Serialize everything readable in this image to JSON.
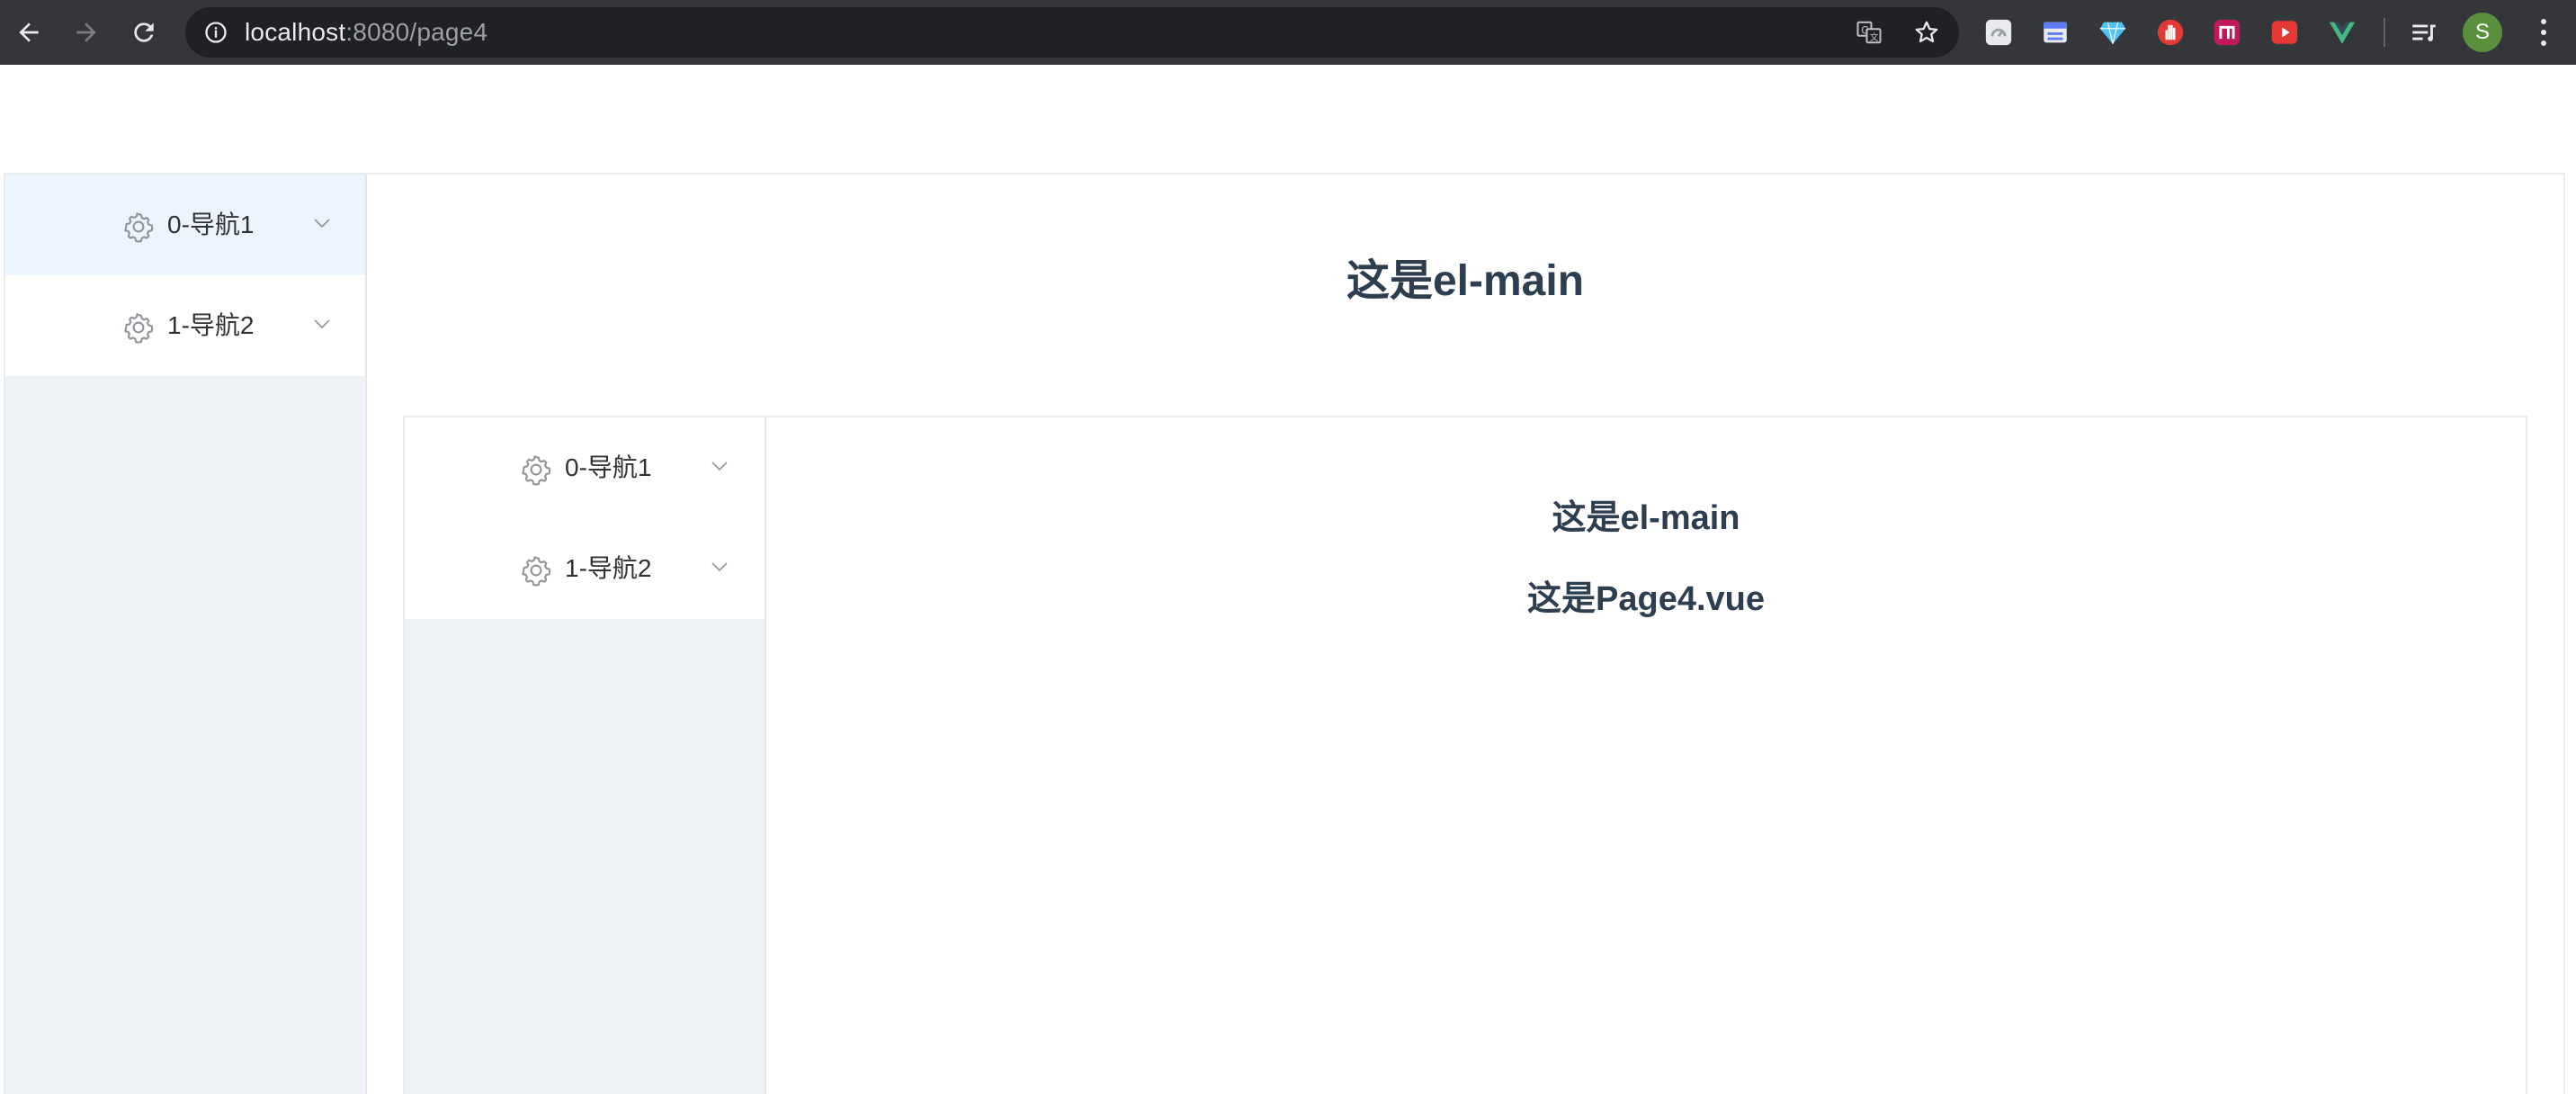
{
  "browser": {
    "url_host": "localhost",
    "url_rest": ":8080/page4",
    "profile_initial": "S",
    "icons": {
      "back": "arrow-left-icon",
      "forward": "arrow-right-icon",
      "reload": "reload-icon",
      "info": "info-icon",
      "translate": "translate-icon",
      "bookmark": "star-icon",
      "media": "media-queue-icon",
      "menu": "vertical-dots-icon"
    },
    "extensions": [
      {
        "name": "speedometer-extension-icon",
        "color": "#e8eaed"
      },
      {
        "name": "window-extension-icon",
        "color": "#8ab4f8"
      },
      {
        "name": "diamond-extension-icon",
        "color": "#4fc3f7"
      },
      {
        "name": "hand-stop-extension-icon",
        "color": "#e53935"
      },
      {
        "name": "n-badge-extension-icon",
        "color": "#c2185b"
      },
      {
        "name": "play-extension-icon",
        "color": "#e53935"
      },
      {
        "name": "vue-extension-icon",
        "color": "#42b883"
      }
    ]
  },
  "outer": {
    "menu": [
      {
        "label": "0-导航1",
        "icon": "gear-icon",
        "active": true
      },
      {
        "label": "1-导航2",
        "icon": "gear-icon",
        "active": false
      }
    ],
    "main_title": "这是el-main"
  },
  "inner": {
    "menu": [
      {
        "label": "0-导航1",
        "icon": "gear-icon"
      },
      {
        "label": "1-导航2",
        "icon": "gear-icon"
      }
    ],
    "main_title": "这是el-main",
    "page_text": "这是Page4.vue"
  },
  "colors": {
    "chrome_bg": "#35363a",
    "omnibox_bg": "#202124",
    "aside_bg": "#eef1f6",
    "active_menu_bg": "#ecf5ff",
    "text": "#2c3e50"
  }
}
